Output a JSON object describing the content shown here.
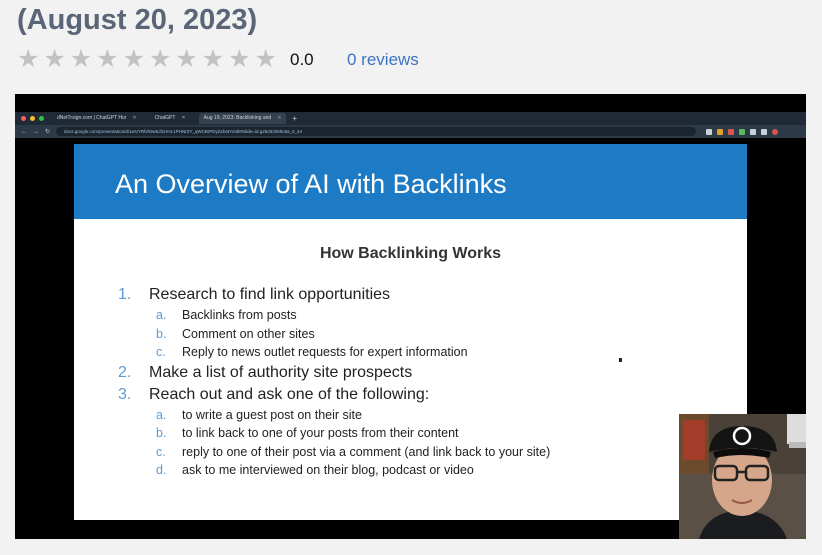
{
  "page": {
    "title": "(August 20, 2023)",
    "rating": {
      "star_count": 10,
      "value": "0.0",
      "reviews_link": "0 reviews",
      "star_color": "#c2c2c2"
    }
  },
  "video": {
    "browser": {
      "tabs": [
        {
          "label": "dNetTrsign.com | ChatGPT Hur",
          "active": false
        },
        {
          "label": "ChatGPT",
          "active": false
        },
        {
          "label": "Aug 19, 2023: Backlinking and",
          "active": true
        }
      ],
      "url": "docs.google.com/presentation/d/1wVYRfvh9w6Jl1HHL1PHNrZY_qWCBrPDyZxhaIY/edit#slide=id.g25d33369c8a_0_44"
    },
    "slide": {
      "header_title": "An Overview of AI with Backlinks",
      "subtitle": "How Backlinking Works",
      "header_color": "#1d7ac4",
      "items": [
        {
          "num": "1.",
          "text": "Research to find link opportunities",
          "subs": [
            {
              "letter": "a.",
              "text": "Backlinks from posts"
            },
            {
              "letter": "b.",
              "text": "Comment on other sites"
            },
            {
              "letter": "c.",
              "text": "Reply to news outlet requests for expert information"
            }
          ]
        },
        {
          "num": "2.",
          "text": "Make a list of authority site prospects",
          "subs": []
        },
        {
          "num": "3.",
          "text": "Reach out and ask one of the following:",
          "subs": [
            {
              "letter": "a.",
              "text": "to write a guest post on their site"
            },
            {
              "letter": "b.",
              "text": "to link back to one of your posts from their content"
            },
            {
              "letter": "c.",
              "text": "reply to one of their post via a comment (and link back to your site)"
            },
            {
              "letter": "d.",
              "text": "ask to me interviewed on their blog, podcast or video"
            }
          ]
        }
      ]
    }
  }
}
